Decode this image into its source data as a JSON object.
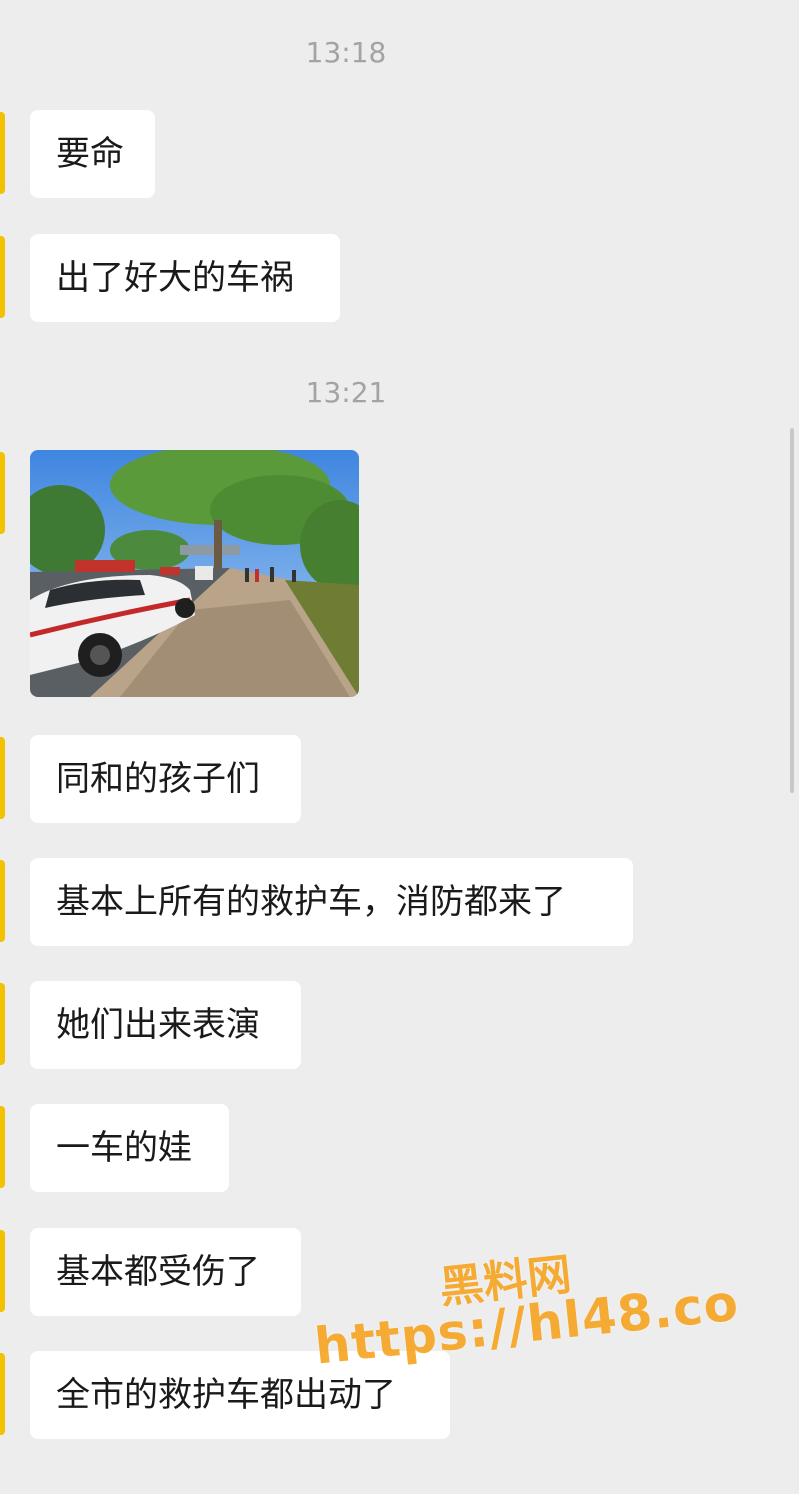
{
  "chat": {
    "groups": [
      {
        "time": "13:18",
        "messages": [
          "要命",
          "出了好大的车祸"
        ]
      },
      {
        "time": "13:21",
        "image": "photo-street-accident-scene",
        "messages": [
          "同和的孩子们",
          "基本上所有的救护车，消防都来了",
          "她们出来表演",
          "一车的娃",
          "基本都受伤了",
          "全市的救护车都出动了"
        ]
      }
    ]
  },
  "watermark": {
    "title": "黑料网",
    "url": "https://hl48.co"
  },
  "colors": {
    "background": "#ededed",
    "bubble": "#ffffff",
    "avatar_accent": "#f2c200",
    "timestamp": "#a3a3a3",
    "watermark": "#f7a21a"
  }
}
